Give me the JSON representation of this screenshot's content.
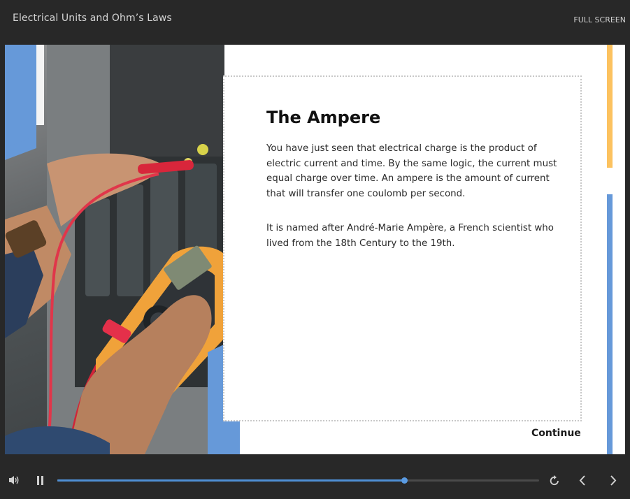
{
  "header": {
    "course_title": "Electrical Units and Ohm’s Laws",
    "fullscreen_label": "FULL SCREEN"
  },
  "slide": {
    "heading": "The Ampere",
    "paragraphs": [
      "You have just seen that electrical charge is the product of electric current and time. By the same logic, the current must equal charge over time. An ampere is the amount of current that will transfer one coulomb per second.",
      "It is named after André-Marie Ampère, a French scientist who lived from the 18th Century to the 19th."
    ],
    "continue_label": "Continue",
    "image_description_icon": "photo-electrician-multimeter"
  },
  "player": {
    "progress": 0.72,
    "buffered": 0.66,
    "icons": {
      "volume": "volume-icon",
      "pause": "pause-icon",
      "replay": "replay-icon",
      "previous": "chevron-left-icon",
      "next": "chevron-right-icon"
    }
  },
  "colors": {
    "accent_blue": "#6699d9",
    "accent_yellow": "#fcc25f",
    "progress_blue": "#4f8fd4",
    "chrome": "#282828"
  }
}
